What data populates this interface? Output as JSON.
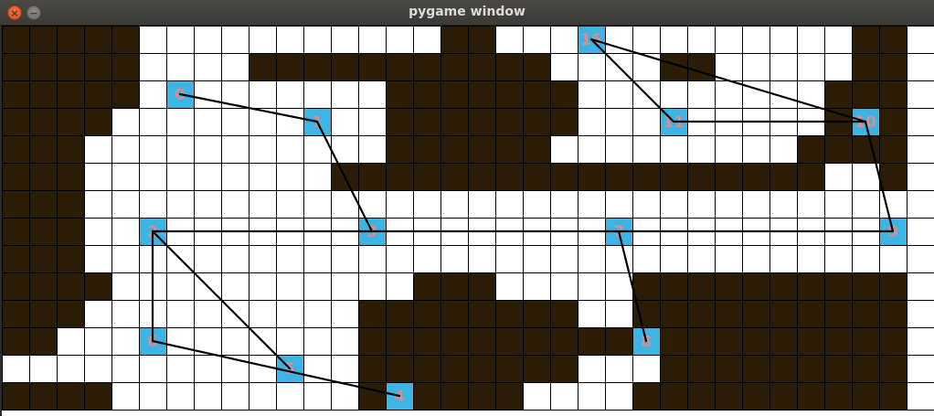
{
  "window": {
    "title": "pygame window"
  },
  "colors": {
    "wall": "#2b1d05",
    "floor": "#ffffff",
    "grid_line": "#000000",
    "node": "#3cb4e4",
    "node_label": "#d0909a",
    "path": "#000000"
  },
  "icons": {
    "close": "close-icon",
    "minimize": "minimize-icon"
  },
  "grid": {
    "cols": 34,
    "rows": 14,
    "map": [
      "#####...........##.............##",
      "#####....###########....##.....##",
      "#####.........#######.........###",
      "####..........#######.........###",
      "###...........######.........####",
      "###.........##################..#",
      "###..............................",
      "###..............................",
      "###..............................",
      "####...........###.....##########",
      "###..........########..##########",
      "##...........##########.#########",
      ".............########...#########",
      "####.........######....##########"
    ],
    "nodes": [
      {
        "id": "n-16",
        "label": "16",
        "col": 21,
        "row": 0
      },
      {
        "id": "n-0",
        "label": "0",
        "col": 6,
        "row": 2
      },
      {
        "id": "n-1",
        "label": "1",
        "col": 11,
        "row": 3
      },
      {
        "id": "n-11",
        "label": "11",
        "col": 24,
        "row": 3
      },
      {
        "id": "n-10",
        "label": "10",
        "col": 31,
        "row": 3
      },
      {
        "id": "n-2",
        "label": "2",
        "col": 5,
        "row": 7
      },
      {
        "id": "n-3",
        "label": "3",
        "col": 13,
        "row": 7
      },
      {
        "id": "n-7",
        "label": "7",
        "col": 22,
        "row": 7
      },
      {
        "id": "n-9",
        "label": "9",
        "col": 32,
        "row": 7
      },
      {
        "id": "n-6",
        "label": "6",
        "col": 5,
        "row": 11
      },
      {
        "id": "n-8",
        "label": "8",
        "col": 23,
        "row": 11
      },
      {
        "id": "n-5",
        "label": "5",
        "col": 10,
        "row": 12
      },
      {
        "id": "n-4",
        "label": "4",
        "col": 14,
        "row": 13
      }
    ],
    "edges": [
      [
        "16",
        "11"
      ],
      [
        "16",
        "10"
      ],
      [
        "11",
        "10"
      ],
      [
        "10",
        "9"
      ],
      [
        "0",
        "1"
      ],
      [
        "1",
        "3"
      ],
      [
        "2",
        "9"
      ],
      [
        "2",
        "6"
      ],
      [
        "2",
        "5"
      ],
      [
        "6",
        "4"
      ],
      [
        "7",
        "8"
      ]
    ]
  }
}
